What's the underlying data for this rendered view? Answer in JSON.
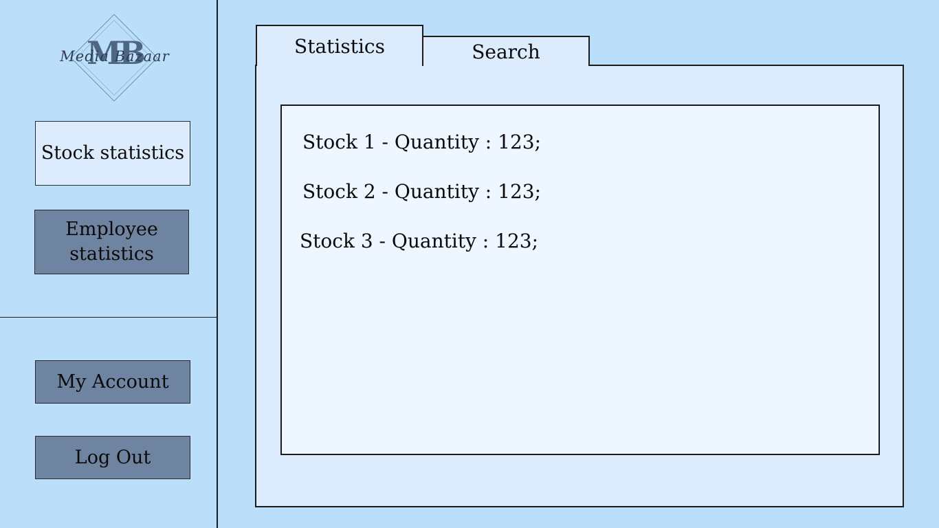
{
  "logo": {
    "monogram": "MB",
    "script_text": "Media Bazaar"
  },
  "sidebar": {
    "stock_statistics": "Stock statistics",
    "employee_statistics": "Employee statistics",
    "my_account": "My Account",
    "log_out": "Log Out"
  },
  "tabs": {
    "statistics": "Statistics",
    "search": "Search"
  },
  "stocks": [
    "Stock 1 - Quantity : 123;",
    "Stock 2 - Quantity : 123;",
    "Stock 3 - Quantity : 123;"
  ],
  "colors": {
    "background": "#bbdefb",
    "light_button": "#ddecfd",
    "dark_button": "#6f84a1",
    "panel": "#ddecfd",
    "inner_box": "#eef6ff"
  }
}
